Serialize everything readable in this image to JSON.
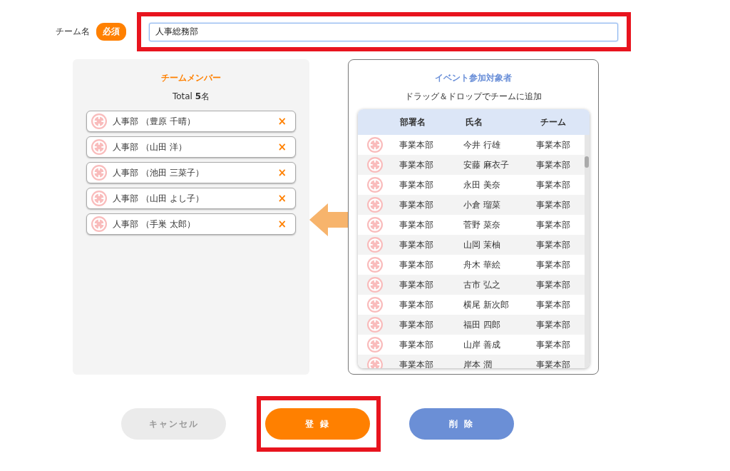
{
  "team_name": {
    "label": "チーム名",
    "badge": "必須",
    "value": "人事総務部"
  },
  "members": {
    "title": "チームメンバー",
    "total": "Total **5**名",
    "items": [
      {
        "text": "人事部 （豊原 千晴）",
        "remove": "×"
      },
      {
        "text": "人事部 （山田 洋）",
        "remove": "×"
      },
      {
        "text": "人事部 （池田 三菜子）",
        "remove": "×"
      },
      {
        "text": "人事部 （山田 よし子）",
        "remove": "×"
      },
      {
        "text": "人事部 （手巣 太郎）",
        "remove": "×"
      }
    ]
  },
  "participants": {
    "title": "イベント参加対象者",
    "hint": "ドラッグ＆ドロップでチームに追加",
    "columns": [
      "部署名",
      "氏名",
      "チーム"
    ],
    "rows": [
      [
        "事業本部",
        "今井 行雄",
        "事業本部"
      ],
      [
        "事業本部",
        "安藤 麻衣子",
        "事業本部"
      ],
      [
        "事業本部",
        "永田 美奈",
        "事業本部"
      ],
      [
        "事業本部",
        "小倉 瑠菜",
        "事業本部"
      ],
      [
        "事業本部",
        "菅野 菜奈",
        "事業本部"
      ],
      [
        "事業本部",
        "山岡 茉柚",
        "事業本部"
      ],
      [
        "事業本部",
        "舟木 華絵",
        "事業本部"
      ],
      [
        "事業本部",
        "古市 弘之",
        "事業本部"
      ],
      [
        "事業本部",
        "横尾 新次郎",
        "事業本部"
      ],
      [
        "事業本部",
        "福田 四郎",
        "事業本部"
      ],
      [
        "事業本部",
        "山岸 善成",
        "事業本部"
      ],
      [
        "事業本部",
        "岸本 潤",
        "事業本部"
      ]
    ]
  },
  "buttons": [
    {
      "label": "キャンセル",
      "kind": "cancel"
    },
    {
      "label": "登 録",
      "kind": "submit"
    },
    {
      "label": "削 除",
      "kind": "delete"
    }
  ]
}
